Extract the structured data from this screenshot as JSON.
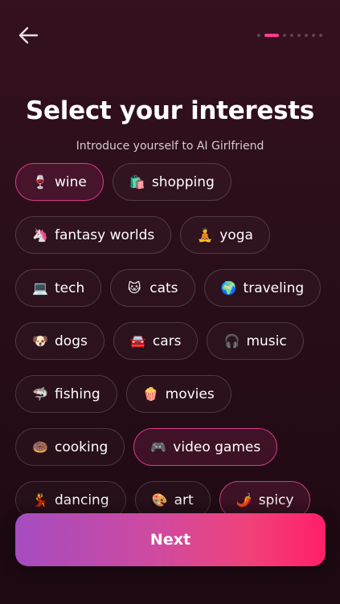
{
  "header": {
    "back_icon": "arrow-left-icon",
    "progress": {
      "total_steps": 8,
      "current_step": 2
    }
  },
  "title": "Select your interests",
  "subtitle": "Introduce yourself to AI Girlfriend",
  "chip_rows": [
    [
      {
        "icon": "🍷",
        "label": "wine",
        "selected": true
      },
      {
        "icon": "🛍️",
        "label": "shopping",
        "selected": false
      }
    ],
    [
      {
        "icon": "🦄",
        "label": "fantasy worlds",
        "selected": false
      },
      {
        "icon": "🧘",
        "label": "yoga",
        "selected": false
      }
    ],
    [
      {
        "icon": "💻",
        "label": "tech",
        "selected": false
      },
      {
        "icon": "🐱",
        "label": "cats",
        "selected": false
      },
      {
        "icon": "🌍",
        "label": "traveling",
        "selected": false
      }
    ],
    [
      {
        "icon": "🐶",
        "label": "dogs",
        "selected": false
      },
      {
        "icon": "🚘",
        "label": "cars",
        "selected": false
      },
      {
        "icon": "🎧",
        "label": "music",
        "selected": false
      }
    ],
    [
      {
        "icon": "🦈",
        "label": "fishing",
        "selected": false
      },
      {
        "icon": "🍿",
        "label": "movies",
        "selected": false
      }
    ],
    [
      {
        "icon": "🍩",
        "label": "cooking",
        "selected": false
      },
      {
        "icon": "🎮",
        "label": "video games",
        "selected": true
      }
    ],
    [
      {
        "icon": "💃",
        "label": "dancing",
        "selected": false
      },
      {
        "icon": "🎨",
        "label": "art",
        "selected": false
      },
      {
        "icon": "🌶️",
        "label": "spicy",
        "selected": true
      }
    ]
  ],
  "next_button": {
    "label": "Next"
  },
  "colors": {
    "accent": "#ff3d8b",
    "selected_border": "#d63a83",
    "button_gradient_start": "#a54cc0",
    "button_gradient_end": "#ff1f6a"
  }
}
